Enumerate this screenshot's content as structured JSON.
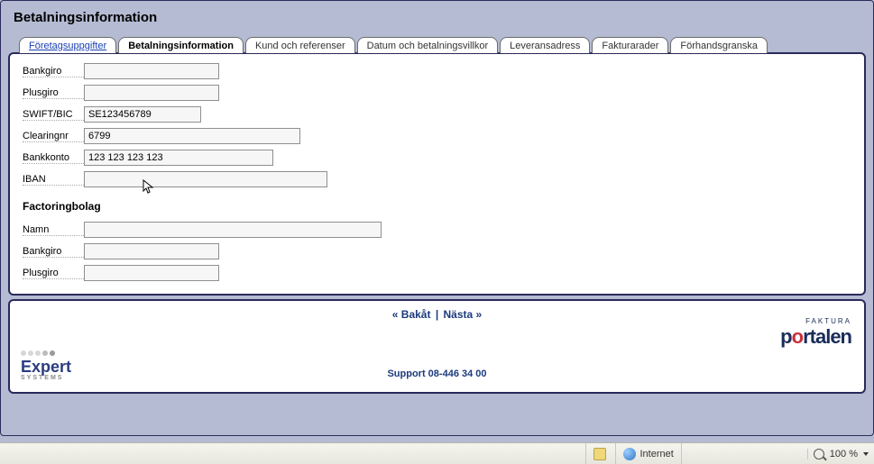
{
  "page_title": "Betalningsinformation",
  "tabs": [
    {
      "label": "Företagsuppgifter",
      "active": false,
      "link": true
    },
    {
      "label": "Betalningsinformation",
      "active": true,
      "link": false
    },
    {
      "label": "Kund och referenser",
      "active": false,
      "link": false
    },
    {
      "label": "Datum och betalningsvillkor",
      "active": false,
      "link": false
    },
    {
      "label": "Leveransadress",
      "active": false,
      "link": false
    },
    {
      "label": "Fakturarader",
      "active": false,
      "link": false
    },
    {
      "label": "Förhandsgranska",
      "active": false,
      "link": false
    }
  ],
  "form": {
    "bankgiro": {
      "label": "Bankgiro",
      "value": ""
    },
    "plusgiro": {
      "label": "Plusgiro",
      "value": ""
    },
    "swift": {
      "label": "SWIFT/BIC",
      "value": "SE123456789"
    },
    "clearing": {
      "label": "Clearingnr",
      "value": "6799"
    },
    "bankkonto": {
      "label": "Bankkonto",
      "value": "123 123 123 123"
    },
    "iban": {
      "label": "IBAN",
      "value": ""
    }
  },
  "factoring": {
    "heading": "Factoringbolag",
    "namn": {
      "label": "Namn",
      "value": ""
    },
    "bankgiro": {
      "label": "Bankgiro",
      "value": ""
    },
    "plusgiro": {
      "label": "Plusgiro",
      "value": ""
    }
  },
  "nav": {
    "back": "« Bakåt",
    "sep": "|",
    "next": "Nästa »"
  },
  "support": "Support 08-446 34 00",
  "logos": {
    "left_main": "Expert",
    "left_sub": "SYSTEMS",
    "right_small": "FAKTURA",
    "right_main_pre": "p",
    "right_main_o": "o",
    "right_main_post": "rtalen"
  },
  "statusbar": {
    "zone": "Internet",
    "zoom": "100 %"
  }
}
